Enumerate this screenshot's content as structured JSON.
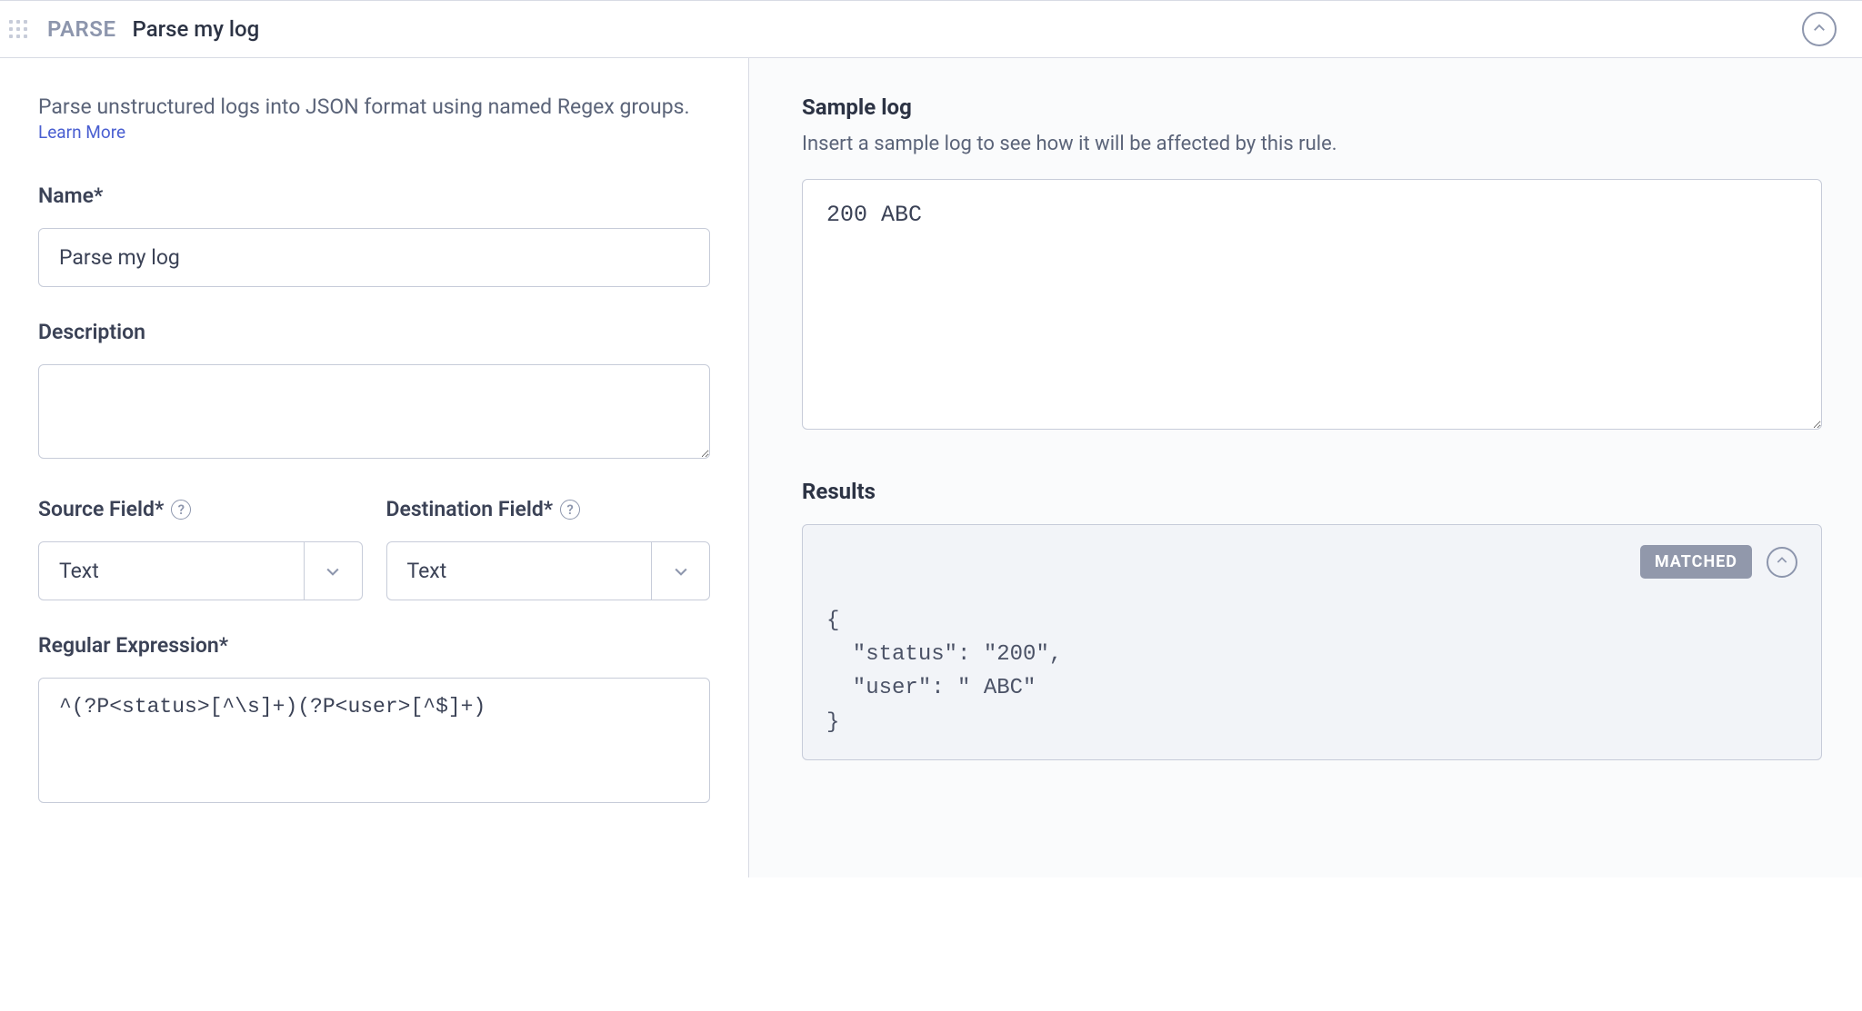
{
  "header": {
    "rule_type": "PARSE",
    "rule_title": "Parse my log"
  },
  "left": {
    "intro_text": "Parse unstructured logs into JSON format using named Regex groups. ",
    "learn_more": "Learn More",
    "name_label": "Name*",
    "name_value": "Parse my log",
    "description_label": "Description",
    "description_value": "",
    "source_field_label": "Source Field*",
    "source_field_value": "Text",
    "destination_field_label": "Destination Field*",
    "destination_field_value": "Text",
    "regex_label": "Regular Expression*",
    "regex_value": "^(?P<status>[^\\s]+)(?P<user>[^$]+)"
  },
  "right": {
    "sample_title": "Sample log",
    "sample_subtitle": "Insert a sample log to see how it will be affected by this rule.",
    "sample_value": "200 ABC",
    "results_title": "Results",
    "match_badge": "MATCHED",
    "results_json": "{\n  \"status\": \"200\",\n  \"user\": \" ABC\"\n}"
  }
}
